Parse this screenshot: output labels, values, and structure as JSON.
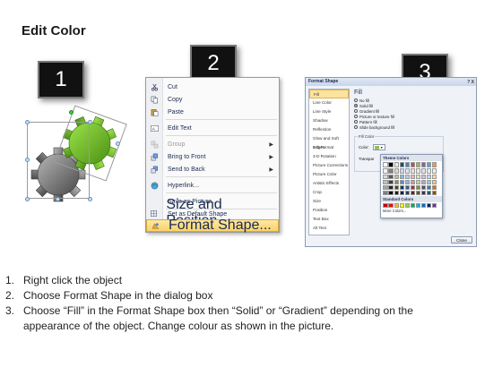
{
  "page": {
    "title": "Edit Color"
  },
  "badges": [
    "1",
    "2",
    "3"
  ],
  "context_menu": {
    "items": [
      {
        "label": "Cut",
        "icon": "scissors-icon",
        "disabled": false,
        "submenu": false
      },
      {
        "label": "Copy",
        "icon": "copy-icon",
        "disabled": false,
        "submenu": false
      },
      {
        "label": "Paste",
        "icon": "paste-icon",
        "disabled": false,
        "submenu": false
      },
      {
        "label": "Edit Text",
        "icon": "edit-text-icon",
        "disabled": false,
        "submenu": false
      },
      {
        "label": "Group",
        "icon": "group-icon",
        "disabled": true,
        "submenu": true
      },
      {
        "label": "Bring to Front",
        "icon": "bring-to-front-icon",
        "disabled": false,
        "submenu": true
      },
      {
        "label": "Send to Back",
        "icon": "send-to-back-icon",
        "disabled": false,
        "submenu": true
      },
      {
        "label": "Hyperlink...",
        "icon": "hyperlink-icon",
        "disabled": false,
        "submenu": false
      },
      {
        "label": "Save as Picture...",
        "icon": "",
        "disabled": false,
        "submenu": false
      },
      {
        "label": "Set as Default Shape",
        "icon": "",
        "disabled": false,
        "submenu": false
      },
      {
        "label": "Size and Position...",
        "icon": "size-position-icon",
        "disabled": false,
        "submenu": false
      },
      {
        "label": "Format Shape...",
        "icon": "format-shape-icon",
        "disabled": false,
        "submenu": false,
        "highlighted": true
      }
    ]
  },
  "dialog": {
    "title": "Format Shape",
    "controls": "? X",
    "categories": [
      "Fill",
      "Line Color",
      "Line Style",
      "Shadow",
      "Reflection",
      "Glow and Soft Edges",
      "3-D Format",
      "3-D Rotation",
      "Picture Corrections",
      "Picture Color",
      "Artistic Effects",
      "Crop",
      "Size",
      "Position",
      "Text Box",
      "Alt Text"
    ],
    "selected_category": "Fill",
    "fill_heading": "Fill",
    "fill_options": [
      {
        "label": "No fill",
        "selected": false
      },
      {
        "label": "Solid fill",
        "selected": true
      },
      {
        "label": "Gradient fill",
        "selected": false
      },
      {
        "label": "Picture or texture fill",
        "selected": false
      },
      {
        "label": "Pattern fill",
        "selected": false
      },
      {
        "label": "Slide background fill",
        "selected": false
      }
    ],
    "fill_color_group": "Fill Color",
    "color_label": "Color:",
    "transparency_label": "Transpar",
    "close_label": "Close"
  },
  "palette": {
    "theme_label": "Theme Colors",
    "standard_label": "Standard Colors",
    "more_label": "More Colors...",
    "theme_top": [
      "#ffffff",
      "#000000",
      "#eeece1",
      "#1f497d",
      "#4f81bd",
      "#c0504d",
      "#9bbb59",
      "#8064a2",
      "#4bacc6",
      "#f79646"
    ],
    "theme_shades": [
      [
        "#f2f2f2",
        "#7f7f7f",
        "#ddd9c3",
        "#c6d9f0",
        "#dbe5f1",
        "#f2dcdb",
        "#ebf1dd",
        "#e5e0ec",
        "#dbeef3",
        "#fdeada"
      ],
      [
        "#d8d8d8",
        "#595959",
        "#c4bd97",
        "#8db3e2",
        "#b8cce4",
        "#e5b9b7",
        "#d7e3bc",
        "#ccc1d9",
        "#b7dde8",
        "#fbd5b5"
      ],
      [
        "#bfbfbf",
        "#3f3f3f",
        "#938953",
        "#548dd4",
        "#95b3d7",
        "#d99694",
        "#c3d69b",
        "#b2a2c7",
        "#92cddc",
        "#fac08f"
      ],
      [
        "#a5a5a5",
        "#262626",
        "#494429",
        "#17365d",
        "#366092",
        "#953734",
        "#76923c",
        "#5f497a",
        "#31859b",
        "#e36c09"
      ],
      [
        "#7f7f7f",
        "#0c0c0c",
        "#1d1b10",
        "#0f243e",
        "#244061",
        "#632423",
        "#4f6128",
        "#3f3151",
        "#205867",
        "#974806"
      ]
    ],
    "standard": [
      "#c00000",
      "#ff0000",
      "#ffc000",
      "#ffff00",
      "#92d050",
      "#00b050",
      "#00b0f0",
      "#0070c0",
      "#002060",
      "#7030a0"
    ]
  },
  "steps": [
    {
      "num": "1.",
      "text": "Right click the object"
    },
    {
      "num": "2.",
      "text": "Choose Format Shape in the dialog box"
    },
    {
      "num": "3.",
      "text": "Choose “Fill” in the Format Shape box then “Solid” or “Gradient” depending on the"
    },
    {
      "num": "",
      "text": "appearance of the object. Change colour as shown in the picture."
    }
  ]
}
